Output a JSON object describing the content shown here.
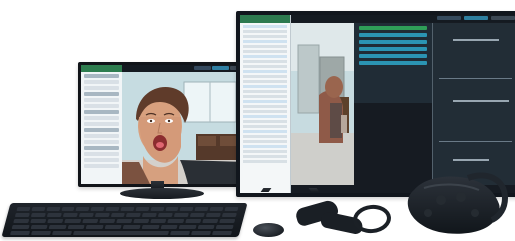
{
  "headline_text": "",
  "icons": {
    "small_monitor": "monitor-icon",
    "large_monitor": "monitor-icon",
    "keyboard": "keyboard-icon",
    "mouse": "mouse-icon",
    "controller": "vr-controller-icon",
    "headset": "vr-headset-icon"
  },
  "colors": {
    "headline": "#1f4ea3",
    "accent_green": "#2e7d4f",
    "overlay_blue": "#2b94b3"
  }
}
